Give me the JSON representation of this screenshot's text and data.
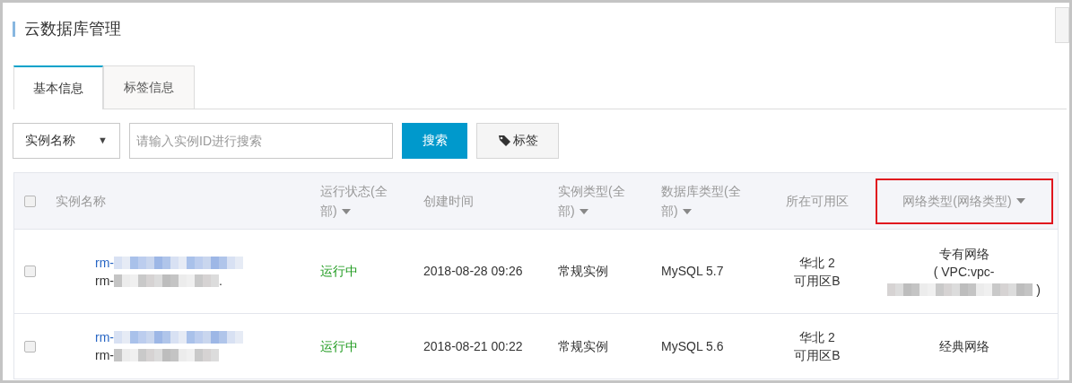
{
  "page_title": "云数据库管理",
  "tabs": [
    {
      "label": "基本信息",
      "selected": true
    },
    {
      "label": "标签信息",
      "selected": false
    }
  ],
  "search": {
    "filter": "实例名称",
    "caret": "▼",
    "placeholder": "请输入实例ID进行搜索",
    "search_button": "搜索",
    "tag_button": "标签"
  },
  "table": {
    "select_all_checked": false,
    "columns": [
      {
        "label": "实例名称",
        "dropdown": false,
        "highlighted": false
      },
      {
        "label": "运行状态(全部)",
        "dropdown": true,
        "highlighted": false
      },
      {
        "label": "创建时间",
        "dropdown": false,
        "highlighted": false
      },
      {
        "label": "实例类型(全部)",
        "dropdown": true,
        "highlighted": false
      },
      {
        "label": "数据库类型(全部)",
        "dropdown": true,
        "highlighted": false
      },
      {
        "label": "所在可用区",
        "dropdown": false,
        "highlighted": false
      },
      {
        "label": "网络类型(网络类型)",
        "dropdown": true,
        "highlighted": true
      }
    ],
    "rows": [
      {
        "checked": false,
        "name": [
          {
            "prefix": "rm-",
            "link": true
          },
          {
            "prefix": "rm-",
            "link": false,
            "suffix": "."
          }
        ],
        "status": "运行中",
        "created": "2018-08-28 09:26",
        "instance_type": "常规实例",
        "db_type": "MySQL 5.7",
        "zone": [
          "华北 2",
          "可用区B"
        ],
        "network": {
          "label": "专有网络",
          "detail_start": "( VPC:vpc-",
          "detail_end": ")"
        }
      },
      {
        "checked": false,
        "name": [
          {
            "prefix": "rm-",
            "link": true
          },
          {
            "prefix": "rm-",
            "link": false
          }
        ],
        "status": "运行中",
        "created": "2018-08-21 00:22",
        "instance_type": "常规实例",
        "db_type": "MySQL 5.6",
        "zone": [
          "华北 2",
          "可用区B"
        ],
        "network": {
          "label": "经典网络"
        }
      }
    ]
  }
}
